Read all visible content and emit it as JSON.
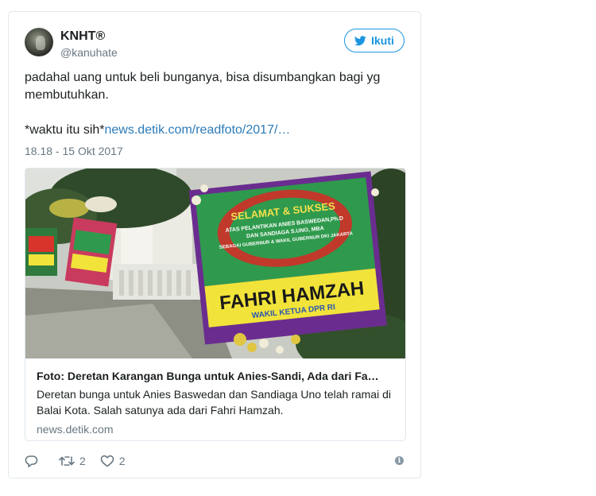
{
  "user": {
    "name": "KNHT®",
    "handle": "@kanuhate"
  },
  "follow": {
    "label": "Ikuti",
    "icon": "twitter-bird-icon"
  },
  "tweet": {
    "line1": "padahal uang untuk beli bunganya, bisa disumbangkan bagi yg",
    "line2": "membutuhkan.",
    "line3_prefix": "*waktu itu sih*",
    "link_text": "news.detik.com/readfoto/2017/…",
    "timestamp": "18.18 - 15 Okt 2017"
  },
  "card": {
    "title": "Foto: Deretan Karangan Bunga untuk Anies-Sandi, Ada dari Fa…",
    "description": "Deretan bunga untuk Anies Baswedan dan Sandiaga Uno telah ramai di Balai Kota. Salah satunya ada dari Fahri Hamzah.",
    "domain": "news.detik.com",
    "image": {
      "board_top_lines": [
        "SELAMAT & SUKSES",
        "ATAS PELANTIKAN ANIES BASWEDAN,Ph.D",
        "DAN SANDIAGA S.UNO, MBA",
        "SEBAGAI GUBERNUR & WAKIL GUBERNUR DKI JAKARTA"
      ],
      "board_name": "FAHRI HAMZAH",
      "board_sub": "WAKIL KETUA DPR RI"
    }
  },
  "actions": {
    "reply_icon": "reply-icon",
    "retweet_count": "2",
    "like_count": "2",
    "info_icon": "info-icon"
  },
  "colors": {
    "accent": "#1b95e0",
    "link": "#2b7bb9",
    "muted": "#697882"
  }
}
